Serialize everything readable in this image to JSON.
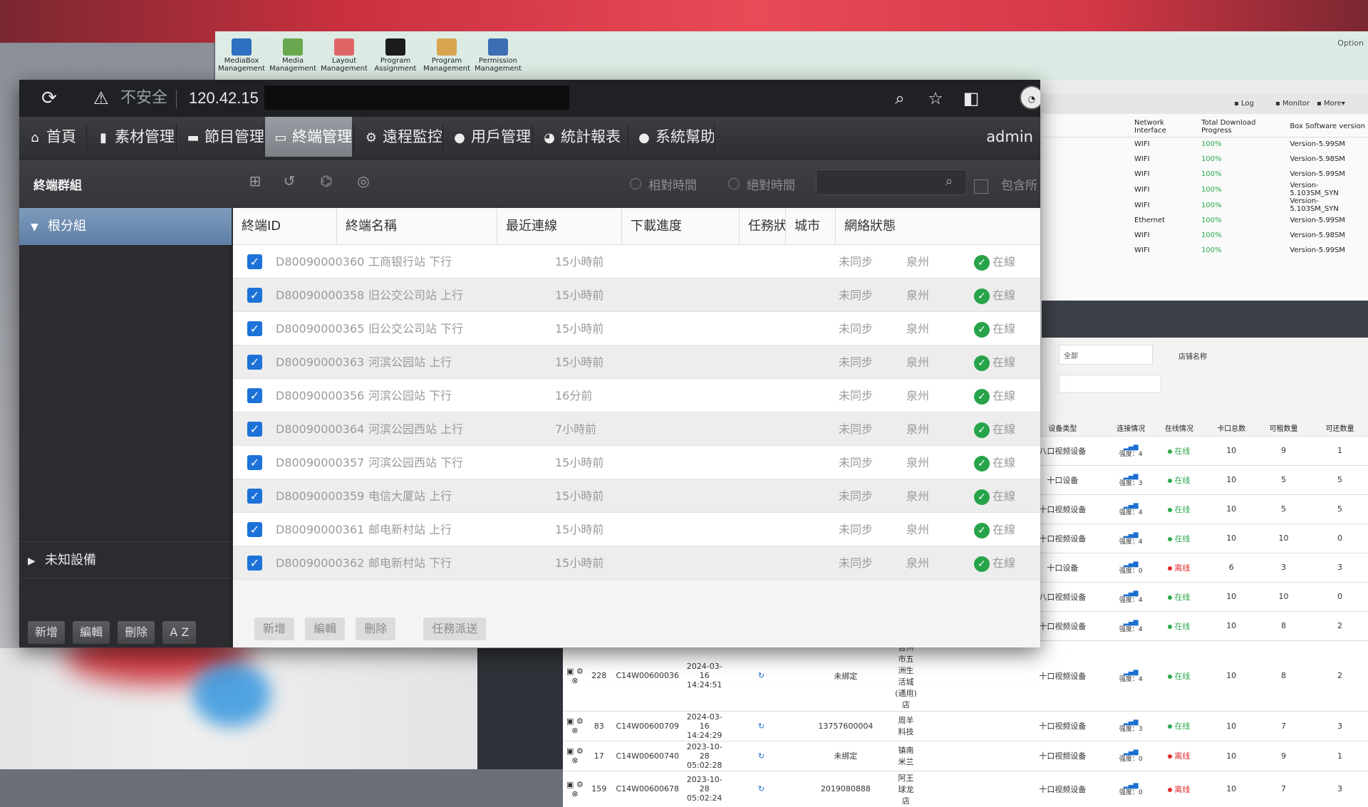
{
  "background_app": {
    "ribbon": [
      {
        "label_top": "MediaBox",
        "label_bottom": "Management",
        "color": "#2d6fc0"
      },
      {
        "label_top": "Media",
        "label_bottom": "Management",
        "color": "#6aa84f"
      },
      {
        "label_top": "Layout",
        "label_bottom": "Management",
        "color": "#e06666"
      },
      {
        "label_top": "Program",
        "label_bottom": "Assignment",
        "color": "#1c1c1c"
      },
      {
        "label_top": "Program",
        "label_bottom": "Management",
        "color": "#d8a550"
      },
      {
        "label_top": "Permission",
        "label_bottom": "Management",
        "color": "#3d6db3"
      }
    ],
    "option_label": "Option",
    "tools": [
      "Log",
      "Monitor",
      "More▾"
    ],
    "net_table": {
      "headers": [
        "Network Interface",
        "Total Download Progress",
        "Box Software version"
      ],
      "rows": [
        [
          "WIFI",
          "100%",
          "Version-5.99SM"
        ],
        [
          "WIFI",
          "100%",
          "Version-5.98SM"
        ],
        [
          "WIFI",
          "100%",
          "Version-5.99SM"
        ],
        [
          "WIFI",
          "100%",
          "Version-5.103SM_SYN"
        ],
        [
          "WIFI",
          "100%",
          "Version-5.103SM_SYN"
        ],
        [
          "Ethernet",
          "100%",
          "Version-5.99SM"
        ],
        [
          "WIFI",
          "100%",
          "Version-5.98SM"
        ],
        [
          "WIFI",
          "100%",
          "Version-5.99SM"
        ]
      ]
    },
    "filter_select": "全部",
    "filter_label": "店铺名称",
    "bottom_table": {
      "headers": [
        "",
        "",
        "",
        "",
        "",
        "",
        "",
        "",
        "设备类型",
        "连接情况",
        "在线情况",
        "卡口总数",
        "可租数量",
        "可还数量"
      ],
      "rows": [
        [
          "",
          "",
          "",
          "",
          "",
          "",
          "",
          "",
          "八口视频设备",
          "强度：4",
          "在线",
          "10",
          "9",
          "1"
        ],
        [
          "",
          "",
          "",
          "",
          "",
          "",
          "",
          "",
          "十口设备",
          "强度：3",
          "在线",
          "10",
          "5",
          "5"
        ],
        [
          "",
          "",
          "",
          "",
          "",
          "",
          "",
          "",
          "十口视频设备",
          "强度：4",
          "在线",
          "10",
          "5",
          "5"
        ],
        [
          "",
          "",
          "",
          "",
          "",
          "",
          "",
          "",
          "十口视频设备",
          "强度：4",
          "在线",
          "10",
          "10",
          "0"
        ],
        [
          "",
          "",
          "",
          "",
          "",
          "",
          "",
          "",
          "十口设备",
          "强度：0",
          "离线",
          "6",
          "3",
          "3"
        ],
        [
          "",
          "",
          "",
          "",
          "",
          "",
          "",
          "",
          "八口视频设备",
          "强度：4",
          "在线",
          "10",
          "10",
          "0"
        ],
        [
          "",
          "",
          "",
          "",
          "",
          "",
          "",
          "",
          "十口视频设备",
          "强度：4",
          "在线",
          "10",
          "8",
          "2"
        ],
        [
          "",
          "228",
          "C14W00600036",
          "2024-03-16 14:24:51",
          "",
          "未绑定",
          "合州市五洲生活城(通用)店",
          "",
          "十口视频设备",
          "强度：4",
          "在线",
          "10",
          "8",
          "2"
        ],
        [
          "",
          "83",
          "C14W00600709",
          "2024-03-16 14:24:29",
          "",
          "13757600004",
          "周羊料技",
          "",
          "十口视频设备",
          "强度：3",
          "在线",
          "10",
          "7",
          "3"
        ],
        [
          "",
          "17",
          "C14W00600740",
          "2023-10-28 05:02:28",
          "",
          "未绑定",
          "镇南米兰",
          "",
          "十口视频设备",
          "强度：0",
          "离线",
          "10",
          "9",
          "1"
        ],
        [
          "",
          "159",
          "C14W00600678",
          "2023-10-28 05:02:24",
          "",
          "2019080888",
          "阿王球龙店",
          "",
          "十口视频设备",
          "强度：0",
          "离线",
          "10",
          "7",
          "3"
        ]
      ]
    }
  },
  "browser": {
    "not_secure": "不安全",
    "url": "120.42.15"
  },
  "menu": {
    "items": [
      {
        "label": "首頁",
        "icon": "home-icon",
        "glyph": "⌂"
      },
      {
        "label": "素材管理",
        "icon": "document-icon",
        "glyph": "▮"
      },
      {
        "label": "節目管理",
        "icon": "folder-icon",
        "glyph": "▬"
      },
      {
        "label": "終端管理",
        "icon": "monitor-icon",
        "glyph": "▭"
      },
      {
        "label": "遠程監控",
        "icon": "gear-icon",
        "glyph": "⚙"
      },
      {
        "label": "用戶管理",
        "icon": "user-icon",
        "glyph": "●"
      },
      {
        "label": "統計報表",
        "icon": "chart-icon",
        "glyph": "◕"
      },
      {
        "label": "系統幫助",
        "icon": "bulb-icon",
        "glyph": "●"
      }
    ],
    "active_index": 3,
    "user": "admin"
  },
  "toolbar": {
    "group_title": "終端群組",
    "relative_time": "相對時間",
    "absolute_time": "絕對時間",
    "search_placeholder": "",
    "include_label": "包含所"
  },
  "sidebar": {
    "root_group": "根分組",
    "unknown_device": "未知設備",
    "buttons": [
      "新增",
      "編輯",
      "刪除",
      "A Z"
    ]
  },
  "table": {
    "headers": [
      "終端ID",
      "終端名稱",
      "最近連線",
      "下載進度",
      "任務狀態",
      "城市",
      "網絡狀態"
    ],
    "rows": [
      {
        "id": "D80090000360",
        "name": "工商银行站 下行",
        "last": "15小時前",
        "progress": "",
        "task": "未同步",
        "city": "泉州",
        "net": "在線"
      },
      {
        "id": "D80090000358",
        "name": "旧公交公司站 上行",
        "last": "15小時前",
        "progress": "",
        "task": "未同步",
        "city": "泉州",
        "net": "在線"
      },
      {
        "id": "D80090000365",
        "name": "旧公交公司站 下行",
        "last": "15小時前",
        "progress": "",
        "task": "未同步",
        "city": "泉州",
        "net": "在線"
      },
      {
        "id": "D80090000363",
        "name": "河滨公园站 上行",
        "last": "15小時前",
        "progress": "",
        "task": "未同步",
        "city": "泉州",
        "net": "在線"
      },
      {
        "id": "D80090000356",
        "name": "河滨公园站 下行",
        "last": "16分前",
        "progress": "",
        "task": "未同步",
        "city": "泉州",
        "net": "在線"
      },
      {
        "id": "D80090000364",
        "name": "河滨公园西站 上行",
        "last": "7小時前",
        "progress": "",
        "task": "未同步",
        "city": "泉州",
        "net": "在線"
      },
      {
        "id": "D80090000357",
        "name": "河滨公园西站 下行",
        "last": "15小時前",
        "progress": "",
        "task": "未同步",
        "city": "泉州",
        "net": "在線"
      },
      {
        "id": "D80090000359",
        "name": "电信大厦站 上行",
        "last": "15小時前",
        "progress": "",
        "task": "未同步",
        "city": "泉州",
        "net": "在線"
      },
      {
        "id": "D80090000361",
        "name": "邮电新村站 上行",
        "last": "15小時前",
        "progress": "",
        "task": "未同步",
        "city": "泉州",
        "net": "在線"
      },
      {
        "id": "D80090000362",
        "name": "邮电新村站 下行",
        "last": "15小時前",
        "progress": "",
        "task": "未同步",
        "city": "泉州",
        "net": "在線"
      }
    ],
    "buttons": [
      "新增",
      "編輯",
      "刪除",
      "任務派送"
    ]
  }
}
